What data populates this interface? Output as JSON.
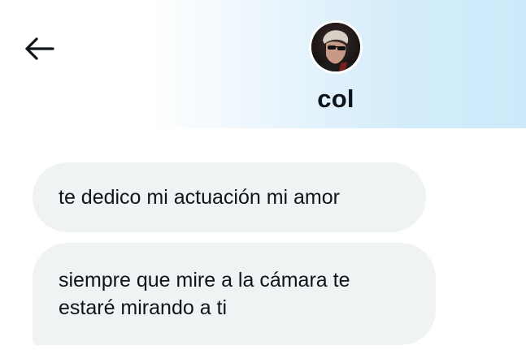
{
  "header": {
    "username": "col",
    "avatar_alt": "profile photo",
    "back_icon": "arrow-left-icon",
    "gradient_colors": [
      "#ffffff",
      "#cde9f9"
    ]
  },
  "messages": [
    {
      "lines": [
        "te dedico mi actuación mi amor"
      ]
    },
    {
      "lines": [
        "siempre que mire a la cámara te",
        "estaré mirando a ti"
      ]
    }
  ],
  "colors": {
    "bubble_bg": "#eff3f4",
    "text": "#0f1419"
  }
}
